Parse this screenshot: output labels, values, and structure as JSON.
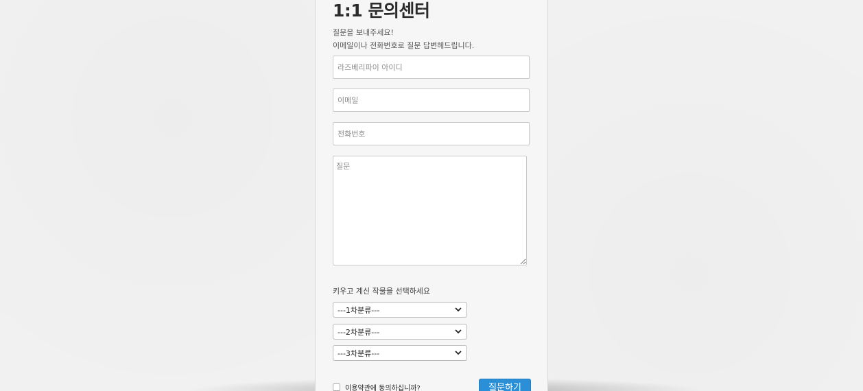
{
  "page": {
    "title": "1:1 문의센터",
    "desc_line1": "질문을 보내주세요!",
    "desc_line2": "이메일이나 전화번호로 질문 답변헤드립니다."
  },
  "form": {
    "id_placeholder": "라즈베리파이 아이디",
    "email_placeholder": "이메일",
    "phone_placeholder": "전화번호",
    "question_placeholder": "질문",
    "category_label": "키우고 계신 작물을 선택하세요",
    "category1": "---1차분류---",
    "category2": "---2차분류---",
    "category3": "---3차분류---",
    "agree_label": "이용약관에 동의하십니까?",
    "submit_label": "질문하기"
  },
  "icons": {
    "select_arrow": "chevron-down-icon"
  }
}
